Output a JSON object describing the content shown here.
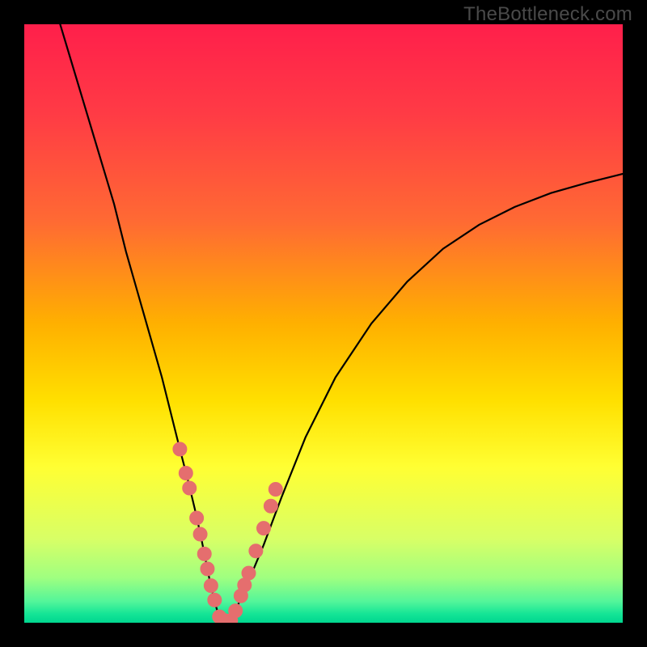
{
  "watermark": {
    "text": "TheBottleneck.com"
  },
  "colors": {
    "frame": "#000000",
    "curve": "#000000",
    "marker_fill": "#e56e6e",
    "marker_stroke": "#e56e6e",
    "gradient_stops": [
      {
        "offset": 0.0,
        "color": "#ff1f4b"
      },
      {
        "offset": 0.15,
        "color": "#ff3b45"
      },
      {
        "offset": 0.33,
        "color": "#ff6a33"
      },
      {
        "offset": 0.5,
        "color": "#ffb000"
      },
      {
        "offset": 0.63,
        "color": "#ffe000"
      },
      {
        "offset": 0.74,
        "color": "#ffff33"
      },
      {
        "offset": 0.86,
        "color": "#d8ff66"
      },
      {
        "offset": 0.925,
        "color": "#9fff80"
      },
      {
        "offset": 0.965,
        "color": "#52f59a"
      },
      {
        "offset": 0.985,
        "color": "#15e596"
      },
      {
        "offset": 1.0,
        "color": "#00d68f"
      }
    ]
  },
  "chart_data": {
    "type": "line",
    "title": "",
    "xlabel": "",
    "ylabel": "",
    "xlim": [
      0,
      100
    ],
    "ylim": [
      0,
      100
    ],
    "series": [
      {
        "name": "bottleneck-curve",
        "x": [
          6,
          9,
          12,
          15,
          17,
          19,
          21,
          23,
          24.5,
          26,
          27.3,
          28.5,
          29.5,
          30.3,
          31,
          31.7,
          32.3,
          33,
          34,
          35.5,
          37.5,
          40,
          43,
          47,
          52,
          58,
          64,
          70,
          76,
          82,
          88,
          94,
          100
        ],
        "y": [
          100,
          90,
          80,
          70,
          62,
          55,
          48,
          41,
          35,
          29,
          24,
          19,
          14.5,
          10.5,
          7,
          4,
          1.8,
          0.35,
          0.35,
          2.5,
          7,
          13,
          21,
          31,
          41,
          50,
          57,
          62.5,
          66.5,
          69.5,
          71.8,
          73.5,
          75
        ]
      }
    ],
    "markers": {
      "name": "highlight-points",
      "x": [
        26.0,
        27.0,
        27.6,
        28.8,
        29.4,
        30.1,
        30.6,
        31.2,
        31.8,
        32.6,
        33.5,
        34.5,
        35.3,
        36.2,
        36.8,
        37.5,
        38.7,
        40.0,
        41.2,
        42.0
      ],
      "y": [
        29.0,
        25.0,
        22.5,
        17.5,
        14.8,
        11.5,
        9.0,
        6.2,
        3.8,
        1.0,
        0.35,
        0.35,
        2.0,
        4.5,
        6.3,
        8.3,
        12.0,
        15.8,
        19.5,
        22.3
      ]
    }
  }
}
